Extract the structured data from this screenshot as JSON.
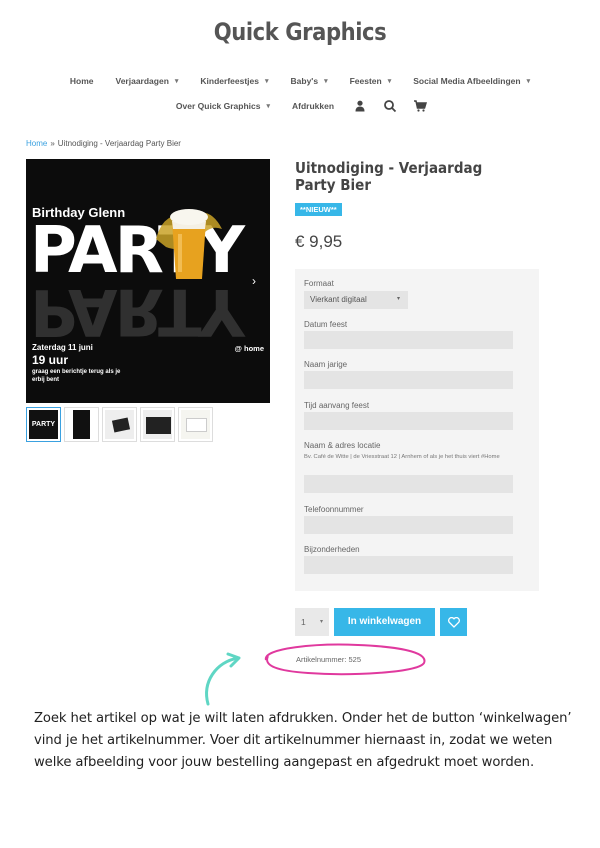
{
  "site": {
    "logo": "Quick Graphics"
  },
  "nav": {
    "row1": [
      {
        "label": "Home",
        "has_caret": false
      },
      {
        "label": "Verjaardagen",
        "has_caret": true
      },
      {
        "label": "Kinderfeestjes",
        "has_caret": true
      },
      {
        "label": "Baby's",
        "has_caret": true
      },
      {
        "label": "Feesten",
        "has_caret": true
      },
      {
        "label": "Social Media Afbeeldingen",
        "has_caret": true
      }
    ],
    "row2": [
      {
        "label": "Over Quick Graphics",
        "has_caret": true
      },
      {
        "label": "Afdrukken",
        "has_caret": false
      }
    ],
    "icons": [
      "user-icon",
      "search-icon",
      "cart-icon"
    ]
  },
  "breadcrumb": {
    "home": "Home",
    "separator": "»",
    "current": "Uitnodiging - Verjaardag Party Bier"
  },
  "product": {
    "title": "Uitnodiging - Verjaardag Party Bier",
    "badge": "**NIEUW**",
    "price": "€ 9,95",
    "image": {
      "headline": "Birthday Glenn",
      "big_word": "PARTY",
      "date": "Zaterdag 11 juni",
      "time": "19 uur",
      "message": "graag een berichtje terug als je erbij bent",
      "location_tag": "@ home"
    },
    "thumbnails": 5
  },
  "form": {
    "format_label": "Formaat",
    "format_value": "Vierkant digitaal",
    "date_label": "Datum feest",
    "name_label": "Naam jarige",
    "time_label": "Tijd aanvang feest",
    "location_label": "Naam & adres locatie",
    "location_hint": "Bv. Café de Witte | de Vriesstraat 12 | Arnhem of als je het thuis viert #Home",
    "phone_label": "Telefoonnummer",
    "notes_label": "Bijzonderheden"
  },
  "purchase": {
    "qty": "1",
    "cart_label": "In winkelwagen",
    "article_number": "Artikelnummer: 525"
  },
  "instructions": "Zoek het artikel op wat je wilt laten afdrukken. Onder het de button ‘winkelwagen’ vind je het artikelnummer. Voer dit artikelnummer hiernaast in, zodat we weten welke afbeelding voor jouw bestelling aangepast en afgedrukt moet worden.",
  "colors": {
    "accent": "#37b7e8",
    "highlight_circle": "#e0399e",
    "hand_arrow": "#5fd6c4"
  }
}
